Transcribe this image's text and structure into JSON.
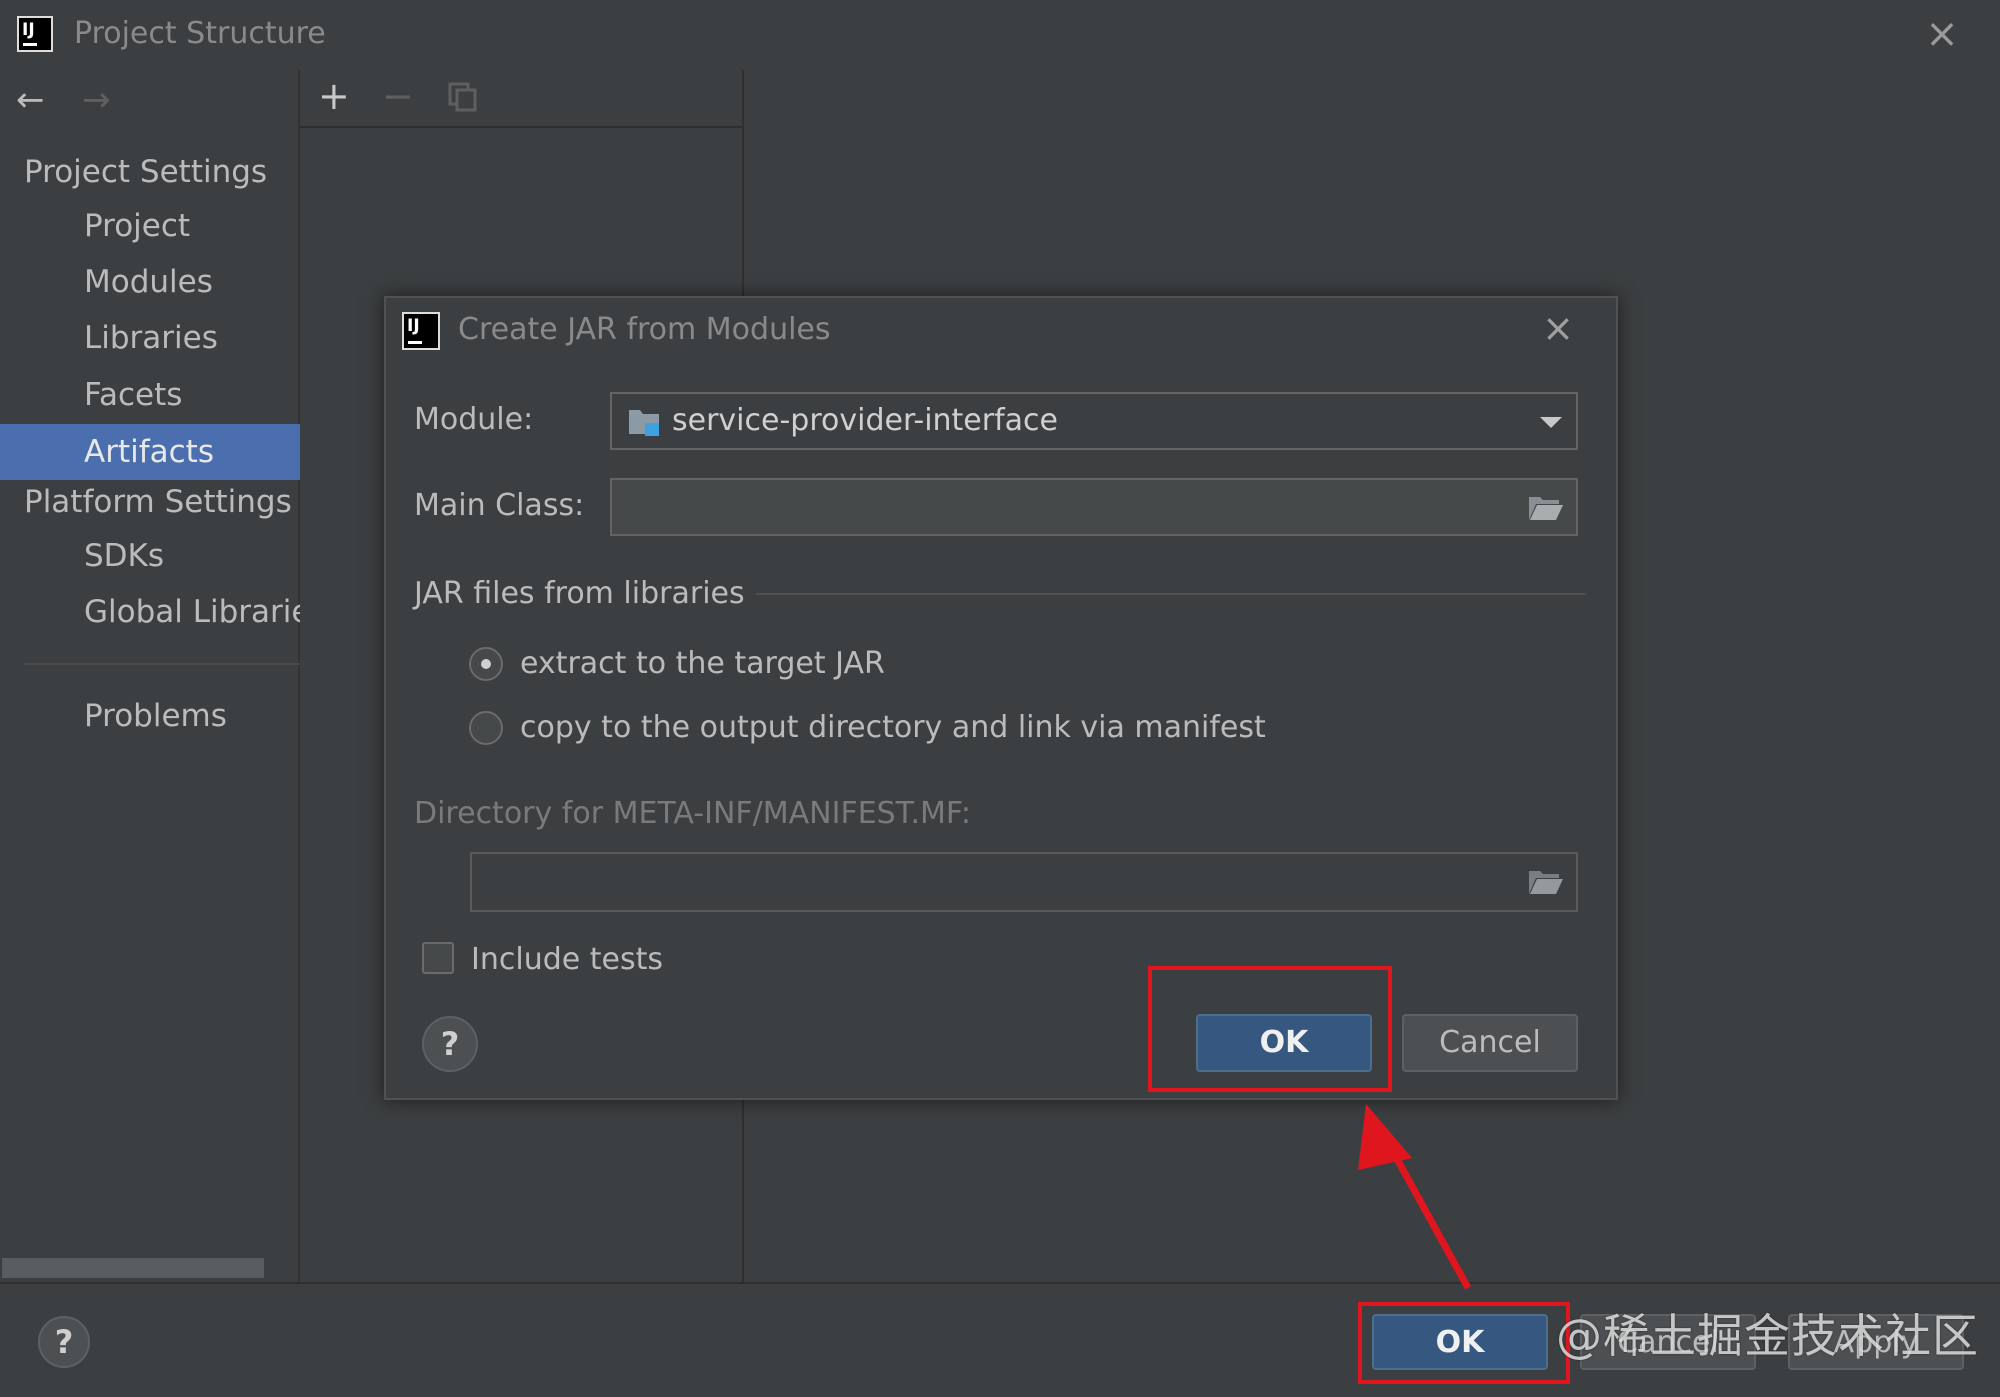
{
  "window": {
    "title": "Project Structure"
  },
  "sidebar": {
    "project_settings_header": "Project Settings",
    "items": [
      {
        "label": "Project"
      },
      {
        "label": "Modules"
      },
      {
        "label": "Libraries"
      },
      {
        "label": "Facets"
      },
      {
        "label": "Artifacts",
        "selected": true
      }
    ],
    "platform_settings_header": "Platform Settings",
    "platform_items": [
      {
        "label": "SDKs"
      },
      {
        "label": "Global Libraries"
      }
    ],
    "problems_label": "Problems"
  },
  "bottom": {
    "ok_label": "OK",
    "cancel_label": "Cancel",
    "apply_label": "Apply",
    "help_label": "?"
  },
  "dialog": {
    "title": "Create JAR from Modules",
    "module_label": "Module:",
    "module_value": "service-provider-interface",
    "main_class_label": "Main Class:",
    "main_class_value": "",
    "jar_group_label": "JAR files from libraries",
    "option_extract": "extract to the target JAR",
    "option_copy": "copy to the output directory and link via manifest",
    "selected_option": "extract",
    "manifest_dir_label": "Directory for META-INF/MANIFEST.MF:",
    "manifest_dir_value": "",
    "include_tests_label": "Include tests",
    "include_tests_checked": false,
    "ok_label": "OK",
    "cancel_label": "Cancel",
    "help_label": "?"
  },
  "annotation": {
    "watermark": "@稀土掘金技术社区",
    "highlight_color": "#e0161f"
  },
  "colors": {
    "background": "#3c3f41",
    "selection": "#4b6eaf",
    "default_button": "#365880"
  }
}
